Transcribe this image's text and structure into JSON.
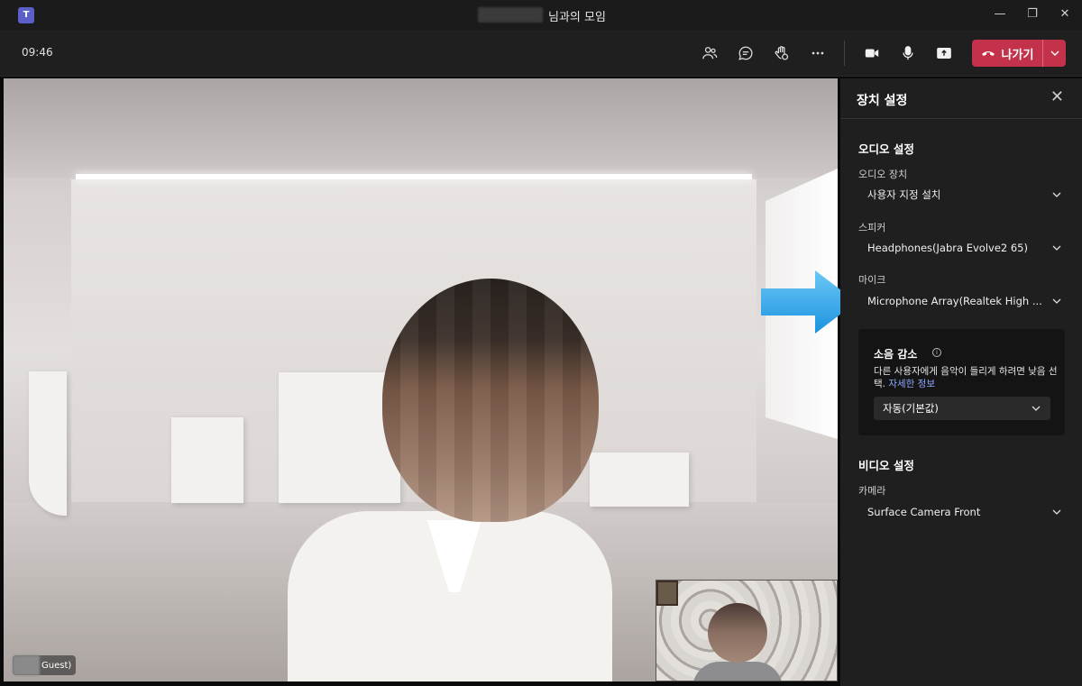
{
  "window": {
    "title": "님과의 모임",
    "minimize": "—",
    "restore": "❐",
    "close": "✕"
  },
  "toolbar": {
    "clock": "09:46",
    "leave_label": "나가기",
    "icons": [
      "people-icon",
      "chat-icon",
      "raise-hand-icon",
      "more-icon",
      "camera-icon",
      "mic-icon",
      "share-icon"
    ]
  },
  "stage": {
    "participant_label": "Guest)"
  },
  "device_settings": {
    "title": "장치 설정",
    "audio_section": "오디오 설정",
    "audio_device_label": "오디오 장치",
    "audio_device_value": "사용자 지정 설치",
    "speaker_label": "스피커",
    "speaker_value": "Headphones(Jabra Evolve2 65)",
    "mic_label": "마이크",
    "mic_value": "Microphone Array(Realtek High ...",
    "noise": {
      "title": "소음 감소",
      "desc": "다른 사용자에게 음악이 들리게 하려면 낮음 선택.",
      "link": "자세한 정보",
      "value": "자동(기본값)"
    },
    "video_section": "비디오 설정",
    "camera_label": "카메라",
    "camera_value": "Surface Camera Front"
  },
  "colors": {
    "leave": "#c4314b",
    "link": "#8fa8ff",
    "arrow": "#2aa8ec",
    "panel_bg": "#1f1f1f"
  }
}
